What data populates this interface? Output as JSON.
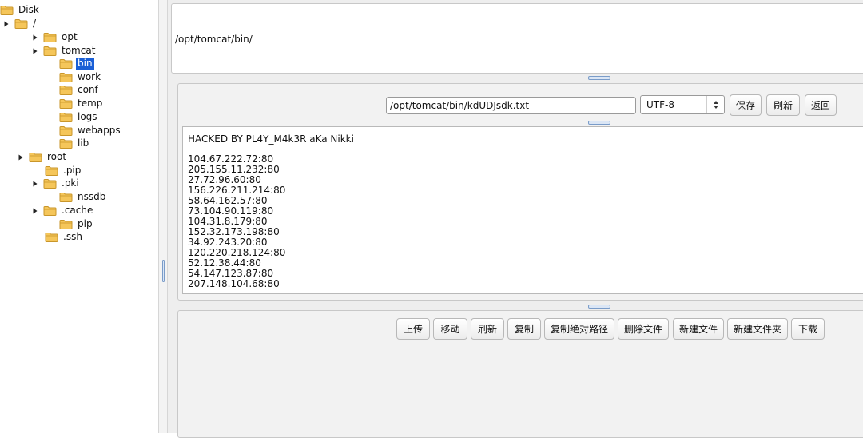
{
  "tree": {
    "root_label": "Disk",
    "nodes": [
      {
        "label": "Disk",
        "arrow": "none",
        "selected": false
      },
      {
        "label": "/",
        "arrow": "expanded",
        "selected": false
      },
      {
        "label": "opt",
        "arrow": "expanded",
        "selected": false
      },
      {
        "label": "tomcat",
        "arrow": "expanded",
        "selected": false
      },
      {
        "label": "bin",
        "arrow": "none",
        "selected": true
      },
      {
        "label": "work",
        "arrow": "none",
        "selected": false
      },
      {
        "label": "conf",
        "arrow": "none",
        "selected": false
      },
      {
        "label": "temp",
        "arrow": "none",
        "selected": false
      },
      {
        "label": "logs",
        "arrow": "none",
        "selected": false
      },
      {
        "label": "webapps",
        "arrow": "none",
        "selected": false
      },
      {
        "label": "lib",
        "arrow": "none",
        "selected": false
      },
      {
        "label": "root",
        "arrow": "expanded",
        "selected": false
      },
      {
        "label": ".pip",
        "arrow": "none",
        "selected": false
      },
      {
        "label": ".pki",
        "arrow": "collapsed",
        "selected": false
      },
      {
        "label": "nssdb",
        "arrow": "none",
        "selected": false
      },
      {
        "label": ".cache",
        "arrow": "collapsed",
        "selected": false
      },
      {
        "label": "pip",
        "arrow": "none",
        "selected": false
      },
      {
        "label": ".ssh",
        "arrow": "none",
        "selected": false
      }
    ]
  },
  "path_pane": {
    "current_path": "/opt/tomcat/bin/"
  },
  "editor": {
    "file_path": "/opt/tomcat/bin/kdUDJsdk.txt",
    "encoding": "UTF-8",
    "save_label": "保存",
    "refresh_label": "刷新",
    "back_label": "返回",
    "header_line": "HACKED BY PL4Y_M4k3R aKa Nikki",
    "lines": [
      "104.67.222.72:80",
      "205.155.11.232:80",
      "27.72.96.60:80",
      "156.226.211.214:80",
      "58.64.162.57:80",
      "73.104.90.119:80",
      "104.31.8.179:80",
      "152.32.173.198:80",
      "34.92.243.20:80",
      "120.220.218.124:80",
      "52.12.38.44:80",
      "54.147.123.87:80",
      "207.148.104.68:80"
    ]
  },
  "toolbar": {
    "upload": "上传",
    "move": "移动",
    "refresh": "刷新",
    "copy": "复制",
    "copy_abs_path": "复制绝对路径",
    "delete_file": "删除文件",
    "new_file": "新建文件",
    "new_folder": "新建文件夹",
    "download": "下载"
  },
  "colors": {
    "selection": "#1a5fd6",
    "folder_fill": "#f5c65a",
    "folder_stroke": "#c9962a"
  }
}
